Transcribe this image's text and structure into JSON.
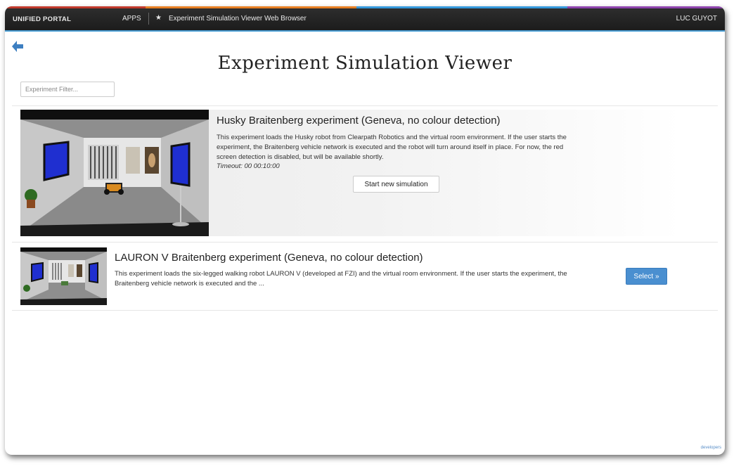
{
  "topbar": {
    "brand": "UNIFIED PORTAL",
    "apps": "APPS",
    "star": "★",
    "title": "Experiment Simulation Viewer Web Browser",
    "user": "LUC GUYOT"
  },
  "page": {
    "title": "Experiment Simulation Viewer",
    "back_icon": "arrow-left-icon"
  },
  "filter": {
    "placeholder": "Experiment Filter..."
  },
  "experiments": [
    {
      "title": "Husky Braitenberg experiment (Geneva, no colour detection)",
      "description": "This experiment loads the Husky robot from Clearpath Robotics and the virtual room environment. If the user starts the experiment, the Braitenberg vehicle network is executed and the robot will turn around itself in place. For now, the red screen detection is disabled, but will be available shortly.",
      "timeout": "Timeout: 00 00:10:00",
      "action": "Start new simulation"
    },
    {
      "title": "LAURON V Braitenberg experiment (Geneva, no colour detection)",
      "description": "This experiment loads the six-legged walking robot LAURON V (developed at FZI) and the virtual room environment. If the user starts the experiment, the Braitenberg vehicle network is executed and the ...",
      "action": "Select »"
    }
  ],
  "footer": "developers",
  "colors": {
    "topbar_bg": "#232323",
    "accent": "#4a9fd5",
    "select_button": "#4a8fd0"
  }
}
